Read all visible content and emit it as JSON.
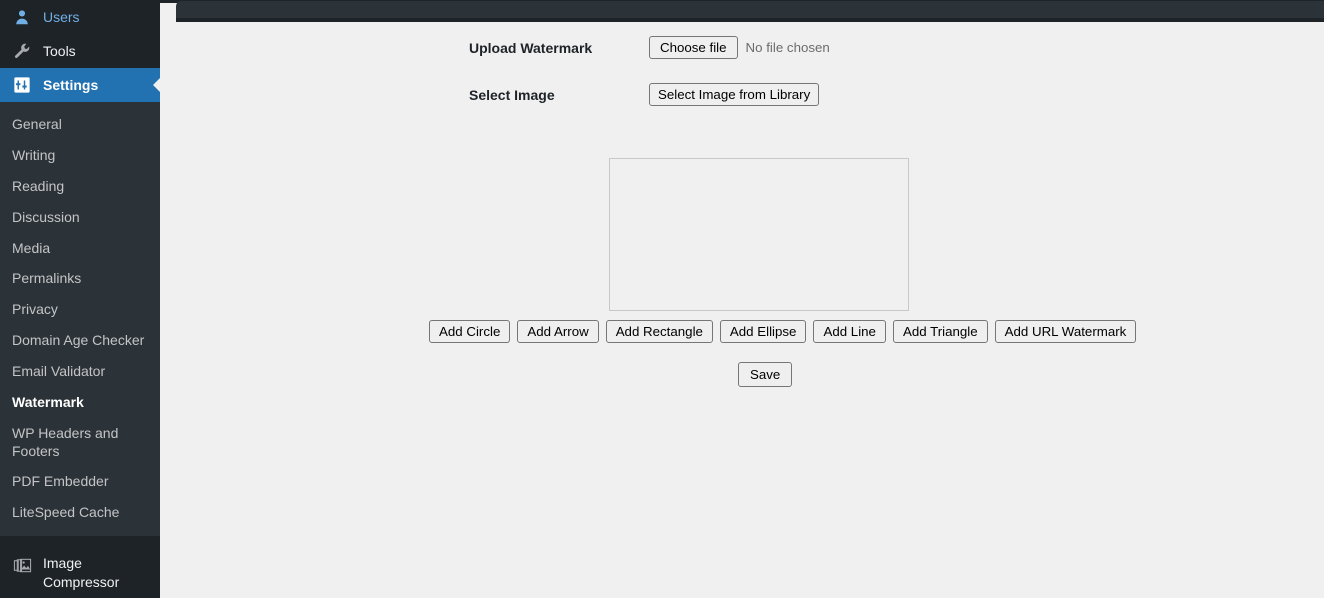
{
  "colors": {
    "sidebar_bg": "#1d2327",
    "submenu_bg": "#2c3338",
    "active_blue": "#2271b1",
    "icon_blue": "#72aee6",
    "content_bg": "#f0f0f1",
    "canvas_border": "#c8c8c8",
    "button_border": "#767676"
  },
  "sidebar": {
    "top_items": [
      {
        "label": "Users",
        "icon": "users-icon",
        "state": "hover"
      },
      {
        "label": "Tools",
        "icon": "tools-wrench-icon",
        "state": "default"
      },
      {
        "label": "Settings",
        "icon": "settings-sliders-icon",
        "state": "current"
      }
    ],
    "submenu_items": [
      {
        "label": "General",
        "current": false
      },
      {
        "label": "Writing",
        "current": false
      },
      {
        "label": "Reading",
        "current": false
      },
      {
        "label": "Discussion",
        "current": false
      },
      {
        "label": "Media",
        "current": false
      },
      {
        "label": "Permalinks",
        "current": false
      },
      {
        "label": "Privacy",
        "current": false
      },
      {
        "label": "Domain Age Checker",
        "current": false
      },
      {
        "label": "Email Validator",
        "current": false
      },
      {
        "label": "Watermark",
        "current": true
      },
      {
        "label": "WP Headers and Footers",
        "current": false
      },
      {
        "label": "PDF Embedder",
        "current": false
      },
      {
        "label": "LiteSpeed Cache",
        "current": false
      }
    ],
    "bottom_items": [
      {
        "label": "Image Compressor",
        "icon": "image-stack-icon"
      }
    ]
  },
  "main": {
    "upload_watermark": {
      "label": "Upload Watermark",
      "choose_file_label": "Choose file",
      "no_file_text": "No file chosen"
    },
    "select_image": {
      "label": "Select Image",
      "button_label": "Select Image from Library"
    },
    "shape_buttons": [
      {
        "label": "Add Circle"
      },
      {
        "label": "Add Arrow"
      },
      {
        "label": "Add Rectangle"
      },
      {
        "label": "Add Ellipse"
      },
      {
        "label": "Add Line"
      },
      {
        "label": "Add Triangle"
      },
      {
        "label": "Add URL Watermark"
      }
    ],
    "save_label": "Save"
  }
}
